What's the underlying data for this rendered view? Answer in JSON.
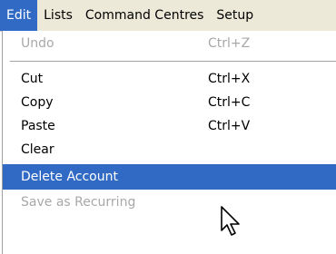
{
  "menubar": {
    "items": [
      {
        "label": "Edit",
        "active": true
      },
      {
        "label": "Lists"
      },
      {
        "label": "Command Centres"
      },
      {
        "label": "Setup"
      }
    ]
  },
  "edit_menu": {
    "items": [
      {
        "label": "Undo",
        "shortcut": "Ctrl+Z",
        "state": "disabled"
      },
      {
        "label": "Cut",
        "shortcut": "Ctrl+X",
        "state": "enabled"
      },
      {
        "label": "Copy",
        "shortcut": "Ctrl+C",
        "state": "enabled"
      },
      {
        "label": "Paste",
        "shortcut": "Ctrl+V",
        "state": "enabled"
      },
      {
        "label": "Clear",
        "shortcut": "",
        "state": "enabled"
      },
      {
        "label": "Delete Account",
        "shortcut": "",
        "state": "highlighted"
      },
      {
        "label": "Save as Recurring",
        "shortcut": "",
        "state": "disabled"
      }
    ]
  },
  "colors": {
    "menubar_bg": "#ece9d8",
    "highlight": "#316ac5",
    "disabled_text": "#a8a8a8"
  },
  "icons": {
    "cursor": "arrow-cursor-icon"
  }
}
